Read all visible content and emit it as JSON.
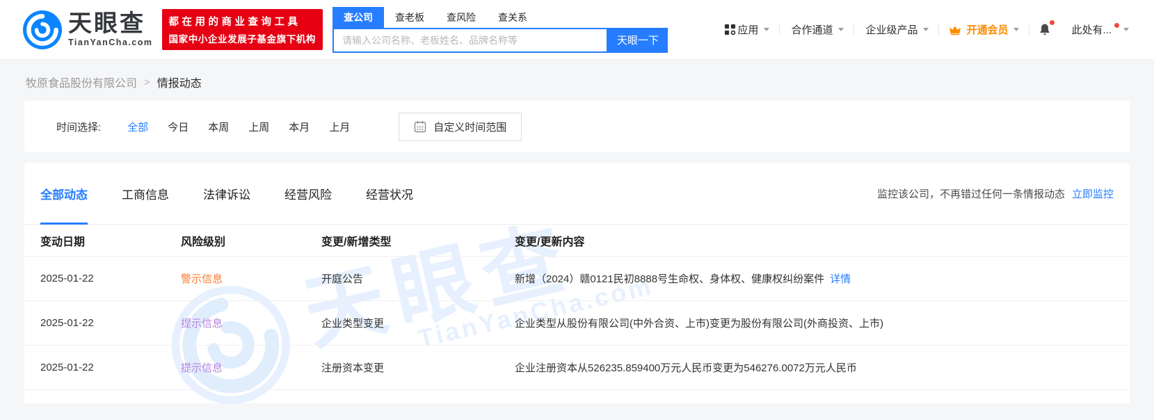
{
  "header": {
    "logo": {
      "brand": "天眼查",
      "domain": "TianYanCha.com"
    },
    "banner": {
      "line1": "都在用的商业查询工具",
      "line2": "国家中小企业发展子基金旗下机构"
    },
    "search": {
      "tabs": [
        "查公司",
        "查老板",
        "查风险",
        "查关系"
      ],
      "active_tab": "查公司",
      "placeholder": "请输入公司名称、老板姓名、品牌名称等",
      "button": "天眼一下"
    },
    "nav": {
      "apps": "应用",
      "coop": "合作通道",
      "enterprise": "企业级产品",
      "vip": "开通会员",
      "more": "此处有..."
    }
  },
  "breadcrumb": {
    "company": "牧原食品股份有限公司",
    "separator": ">",
    "current": "情报动态"
  },
  "time_filter": {
    "label": "时间选择:",
    "options": [
      "全部",
      "今日",
      "本周",
      "上周",
      "本月",
      "上月"
    ],
    "active": "全部",
    "custom_range": "自定义时间范围"
  },
  "main": {
    "tabs": [
      "全部动态",
      "工商信息",
      "法律诉讼",
      "经营风险",
      "经营状况"
    ],
    "active_tab": "全部动态",
    "monitor": {
      "text": "监控该公司，不再错过任何一条情报动态",
      "link": "立即监控"
    },
    "table": {
      "headers": [
        "变动日期",
        "风险级别",
        "变更/新增类型",
        "变更/更新内容"
      ],
      "rows": [
        {
          "date": "2025-01-22",
          "risk": "警示信息",
          "type": "开庭公告",
          "content": "新增（2024）赣0121民初8888号生命权、身体权、健康权纠纷案件",
          "link": "详情"
        },
        {
          "date": "2025-01-22",
          "risk": "提示信息",
          "type": "企业类型变更",
          "content": "企业类型从股份有限公司(中外合资、上市)变更为股份有限公司(外商投资、上市)",
          "link": ""
        },
        {
          "date": "2025-01-22",
          "risk": "提示信息",
          "type": "注册资本变更",
          "content": "企业注册资本从526235.859400万元人民币变更为546276.0072万元人民币",
          "link": ""
        }
      ]
    }
  },
  "watermark": {
    "brand": "天眼查",
    "domain": "TianYanCha.com"
  },
  "colors": {
    "accent": "#267dff",
    "banner_red": "#e50113",
    "vip_orange": "#ff8a00",
    "risk_warn": "#fb7a2e",
    "risk_hint": "#b784e0"
  }
}
